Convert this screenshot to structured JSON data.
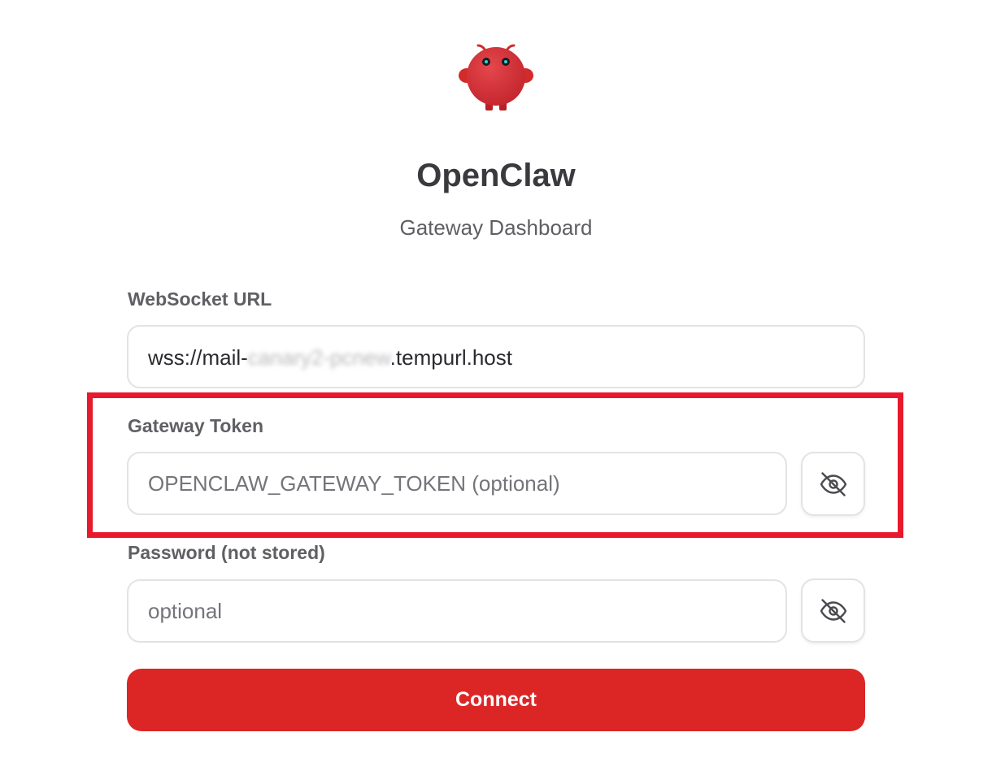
{
  "app": {
    "logo_icon": "red-crab-mascot",
    "title": "OpenClaw",
    "subtitle": "Gateway Dashboard"
  },
  "form": {
    "websocket": {
      "label": "WebSocket URL",
      "value_prefix": "wss://mail-",
      "value_obscured": "canary2-pcnew",
      "value_suffix": ".tempurl.host"
    },
    "token": {
      "label": "Gateway Token",
      "placeholder": "OPENCLAW_GATEWAY_TOKEN (optional)",
      "toggle_icon": "eye-off-icon"
    },
    "password": {
      "label": "Password (not stored)",
      "placeholder": "optional",
      "toggle_icon": "eye-off-icon"
    },
    "connect_label": "Connect"
  },
  "colors": {
    "accent": "#dc2626",
    "highlight": "#e8192c",
    "title_text": "#3a3a3e",
    "border": "#e3e3e5"
  }
}
